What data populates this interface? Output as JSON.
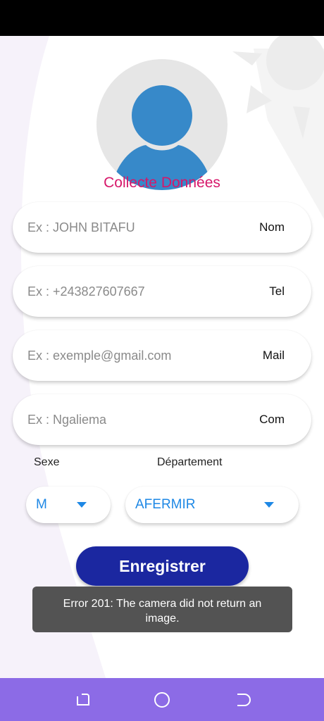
{
  "app": {
    "title": "Collecte Données"
  },
  "form": {
    "fields": [
      {
        "placeholder": "Ex : JOHN BITAFU",
        "value": "",
        "suffix": "Nom",
        "icon": "nom"
      },
      {
        "placeholder": "Ex : +243827607667",
        "value": "",
        "suffix": "Tel",
        "icon": "tel"
      },
      {
        "placeholder": "Ex : exemple@gmail.com",
        "value": "",
        "suffix": "Mail",
        "icon": "mail"
      },
      {
        "placeholder": "Ex : Ngaliema",
        "value": "",
        "suffix": "Com",
        "icon": "com"
      }
    ],
    "sexe_label": "Sexe",
    "sexe_value": "M",
    "departement_label": "Département",
    "departement_value": "AFERMIR",
    "save_label": "Enregistrer"
  },
  "toast": {
    "message": "Error 201: The camera did not return an image."
  },
  "colors": {
    "title": "#d6176a",
    "accent": "#1e88e5",
    "button": "#1b27a0",
    "nav_bar": "#8c6be6",
    "toast_bg": "#535353"
  },
  "nav": {
    "icons": [
      "recent-apps-icon",
      "home-icon",
      "back-icon"
    ]
  }
}
